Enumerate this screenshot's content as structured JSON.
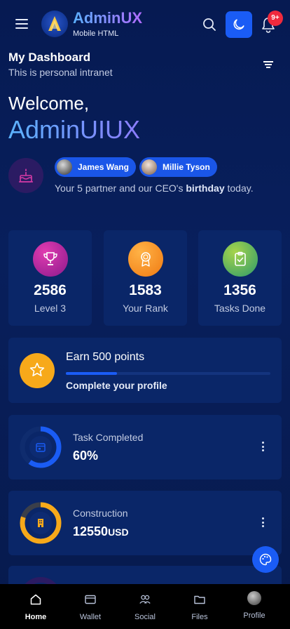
{
  "header": {
    "brand_title": "AdminUX",
    "brand_subtitle": "Mobile HTML",
    "notification_badge": "9+",
    "icons": [
      "menu-icon",
      "logo-icon",
      "search-icon",
      "moon-icon",
      "bell-icon"
    ]
  },
  "dashboard": {
    "title": "My Dashboard",
    "subtitle": "This is personal intranet"
  },
  "welcome": {
    "greeting": "Welcome,",
    "name": "AdminUIUX"
  },
  "birthday": {
    "people": [
      "James Wang",
      "Millie Tyson"
    ],
    "text_prefix": "Your 5 partner and our CEO's",
    "text_bold": "birthday",
    "text_suffix": "today."
  },
  "stats": [
    {
      "value": "2586",
      "label": "Level 3",
      "icon": "trophy-icon",
      "color": "#c21f9a"
    },
    {
      "value": "1583",
      "label": "Your Rank",
      "icon": "medal-icon",
      "color": "#ff8a1f"
    },
    {
      "value": "1356",
      "label": "Tasks Done",
      "icon": "clipboard-check-icon",
      "color": "#3fb87a"
    }
  ],
  "earn": {
    "title": "Earn 500 points",
    "subtitle": "Complete your profile",
    "progress_fraction": 0.25,
    "icon": "star-icon"
  },
  "cards": [
    {
      "label": "Task Completed",
      "value": "60%",
      "unit": "",
      "progress_fraction": 0.6,
      "color": "#1a5cf5",
      "icon": "calendar-icon"
    },
    {
      "label": "Construction",
      "value": "12550",
      "unit": "USD",
      "progress_fraction": 0.8,
      "color": "#f7a91a",
      "icon": "building-icon"
    }
  ],
  "bottom_nav": [
    {
      "label": "Home",
      "icon": "home-icon",
      "active": true
    },
    {
      "label": "Wallet",
      "icon": "wallet-icon",
      "active": false
    },
    {
      "label": "Social",
      "icon": "people-icon",
      "active": false
    },
    {
      "label": "Files",
      "icon": "folder-icon",
      "active": false
    },
    {
      "label": "Profile",
      "icon": "avatar",
      "active": false
    }
  ],
  "colors": {
    "accent": "#1a5cf5",
    "card_bg": "#0a2668",
    "badge": "#ef2a3d"
  }
}
